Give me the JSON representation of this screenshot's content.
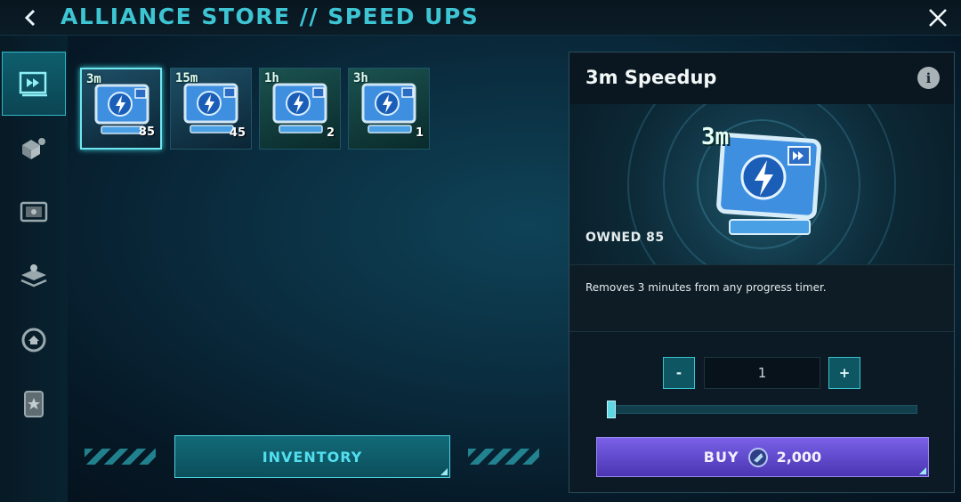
{
  "header": {
    "title": "ALLIANCE STORE // SPEED UPS",
    "back_icon": "chevron-left-icon",
    "close_icon": "close-icon"
  },
  "sidebar": {
    "items": [
      {
        "name": "speedups",
        "icon": "fast-forward-icon",
        "active": true
      },
      {
        "name": "resources",
        "icon": "resource-crate-icon",
        "active": false
      },
      {
        "name": "chests",
        "icon": "chest-icon",
        "active": false
      },
      {
        "name": "territory",
        "icon": "map-layers-icon",
        "active": false
      },
      {
        "name": "base",
        "icon": "home-circle-icon",
        "active": false
      },
      {
        "name": "badges",
        "icon": "star-badge-icon",
        "active": false
      }
    ]
  },
  "items": [
    {
      "label": "3m",
      "count": "85",
      "selected": true
    },
    {
      "label": "15m",
      "count": "45",
      "selected": false
    },
    {
      "label": "1h",
      "count": "2",
      "selected": false
    },
    {
      "label": "3h",
      "count": "1",
      "selected": false
    }
  ],
  "inventory_label": "INVENTORY",
  "detail": {
    "title": "3m Speedup",
    "art_label": "3m",
    "owned": "OWNED 85",
    "description": "Removes 3 minutes from any progress timer.",
    "quantity": "1",
    "minus_label": "-",
    "plus_label": "+",
    "slider_fraction": 0.0,
    "buy_label": "BUY",
    "price": "2,000",
    "info_label": "i"
  },
  "colors": {
    "accent": "#3ec5d4",
    "buy_purple": "#6a52d8",
    "panel_bg": "#0b1a24"
  }
}
